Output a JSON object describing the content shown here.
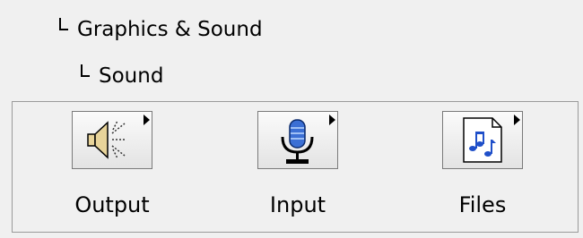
{
  "tree": {
    "parent_label": "Graphics & Sound",
    "child_label": "Sound"
  },
  "palette": {
    "tools": [
      {
        "label": "Output",
        "icon": "speaker-icon"
      },
      {
        "label": "Input",
        "icon": "microphone-icon"
      },
      {
        "label": "Files",
        "icon": "music-file-icon"
      }
    ]
  }
}
